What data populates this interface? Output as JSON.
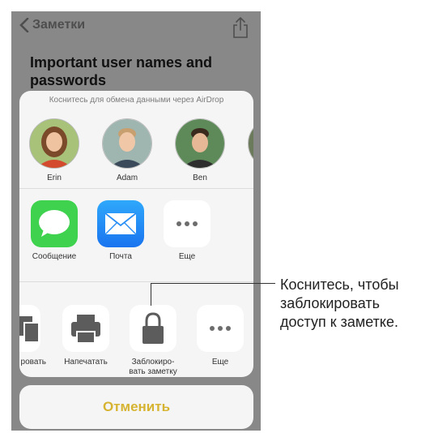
{
  "note": {
    "back_label": "Заметки",
    "title": "Important user names and passwords"
  },
  "share_sheet": {
    "airdrop_hint": "Коснитесь для обмена данными через AirDrop",
    "people": [
      {
        "name": "Erin"
      },
      {
        "name": "Adam"
      },
      {
        "name": "Ben"
      }
    ],
    "apps": [
      {
        "label": "Сообщение",
        "icon": "messages-icon"
      },
      {
        "label": "Почта",
        "icon": "mail-icon"
      },
      {
        "label": "Еще",
        "icon": "more-icon"
      }
    ],
    "actions": [
      {
        "label": "ровать",
        "icon": "copy-icon"
      },
      {
        "label": "Напечатать",
        "icon": "print-icon"
      },
      {
        "label_line1": "Заблокиро-",
        "label_line2": "вать заметку",
        "icon": "lock-icon"
      },
      {
        "label": "Еще",
        "icon": "more-icon"
      }
    ],
    "cancel_label": "Отменить"
  },
  "callout": {
    "line1": "Коснитесь, чтобы",
    "line2": "заблокировать",
    "line3": "доступ к заметке."
  },
  "colors": {
    "cancel_text": "#d6b431",
    "messages_green": "#3fd24f",
    "mail_blue": "#1d8ef5"
  }
}
